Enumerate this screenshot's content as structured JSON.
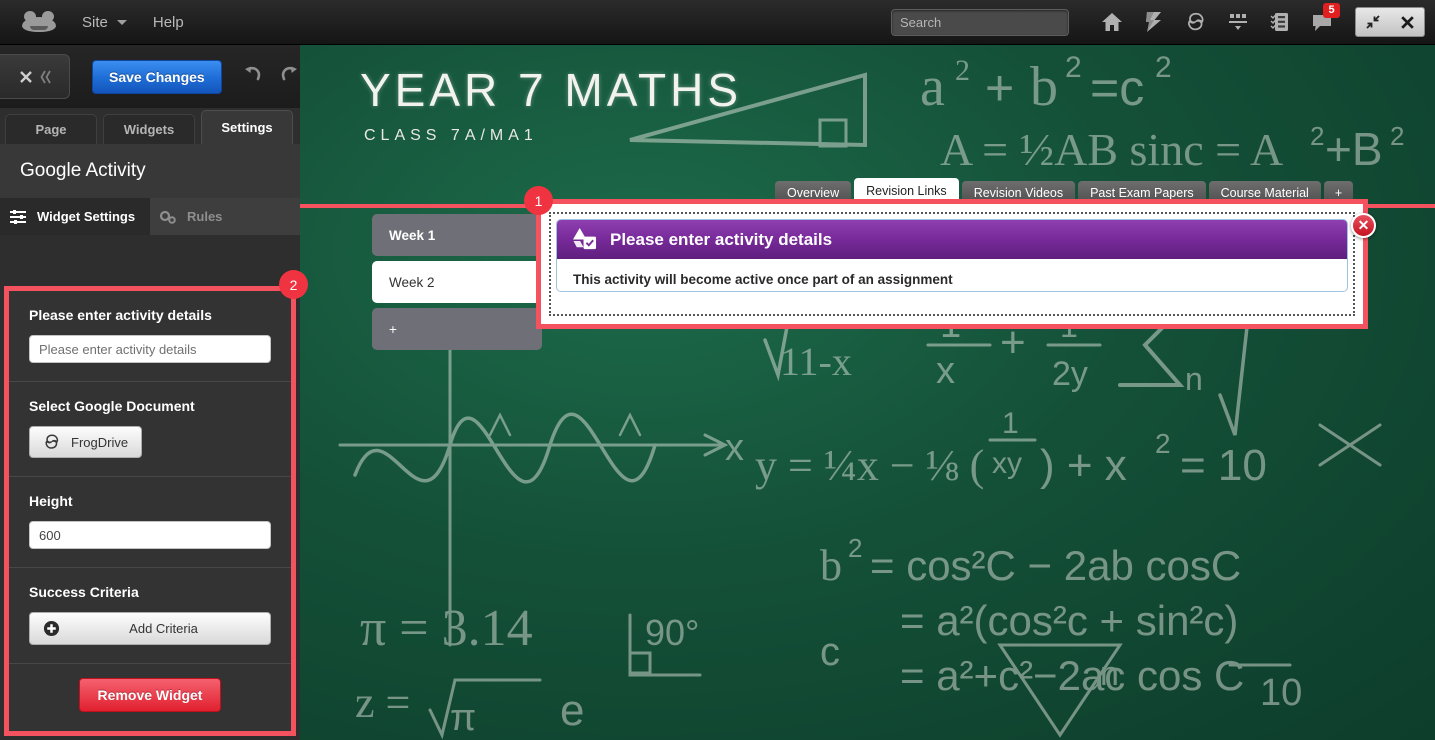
{
  "topbar": {
    "logo_name": "frog-logo",
    "site_label": "Site",
    "help_label": "Help",
    "search_placeholder": "Search",
    "search_value": "",
    "icons": [
      {
        "name": "home-icon",
        "label": "Home"
      },
      {
        "name": "lightning-icon",
        "label": "Quick Launch"
      },
      {
        "name": "frogdrive-icon",
        "label": "FrogDrive"
      },
      {
        "name": "dashboard-icon",
        "label": "Dashboard"
      },
      {
        "name": "assignments-icon",
        "label": "Assignments"
      },
      {
        "name": "messages-icon",
        "label": "Messages"
      }
    ],
    "message_badge": "5",
    "window_restore": "restore-icon",
    "window_close": "close-icon"
  },
  "sidebar": {
    "close_label": "✕",
    "collapse_label": "《",
    "save_label": "Save Changes",
    "undo_label": "undo",
    "redo_label": "redo",
    "tabs": [
      {
        "label": "Page",
        "active": false
      },
      {
        "label": "Widgets",
        "active": false
      },
      {
        "label": "Settings",
        "active": true
      }
    ],
    "panel_title": "Google Activity",
    "subtabs": [
      {
        "label": "Widget Settings",
        "active": true
      },
      {
        "label": "Rules",
        "active": false
      }
    ],
    "fields": {
      "activity_label": "Please enter activity details",
      "activity_placeholder": "Please enter activity details",
      "activity_value": "",
      "document_label": "Select Google Document",
      "document_button": "FrogDrive",
      "height_label": "Height",
      "height_value": "600",
      "criteria_label": "Success Criteria",
      "criteria_button": "Add Criteria",
      "remove_button": "Remove Widget"
    }
  },
  "board": {
    "title": "YEAR 7 MATHS",
    "subtitle": "CLASS 7A/MA1",
    "tabs": [
      {
        "label": "Overview",
        "active": false
      },
      {
        "label": "Revision Links",
        "active": true
      },
      {
        "label": "Revision Videos",
        "active": false
      },
      {
        "label": "Past Exam Papers",
        "active": false
      },
      {
        "label": "Course Material",
        "active": false
      },
      {
        "label": "+",
        "active": false
      }
    ],
    "weeks": [
      {
        "label": "Week 1",
        "state": "gray"
      },
      {
        "label": "Week 2",
        "state": "white"
      },
      {
        "label": "+",
        "state": "add"
      }
    ]
  },
  "modal": {
    "icon_name": "google-drive-activity-icon",
    "title": "Please enter activity details",
    "body": "This activity will become active once part of an assignment",
    "close_label": "✕"
  },
  "annotations": {
    "badge1": "1",
    "badge2": "2"
  },
  "colors": {
    "accent_red": "#f4525f",
    "badge_red": "#ef3340",
    "save_blue": "#1f6fd8",
    "modal_purple": "#7a2b9c",
    "board_green": "#145038"
  }
}
